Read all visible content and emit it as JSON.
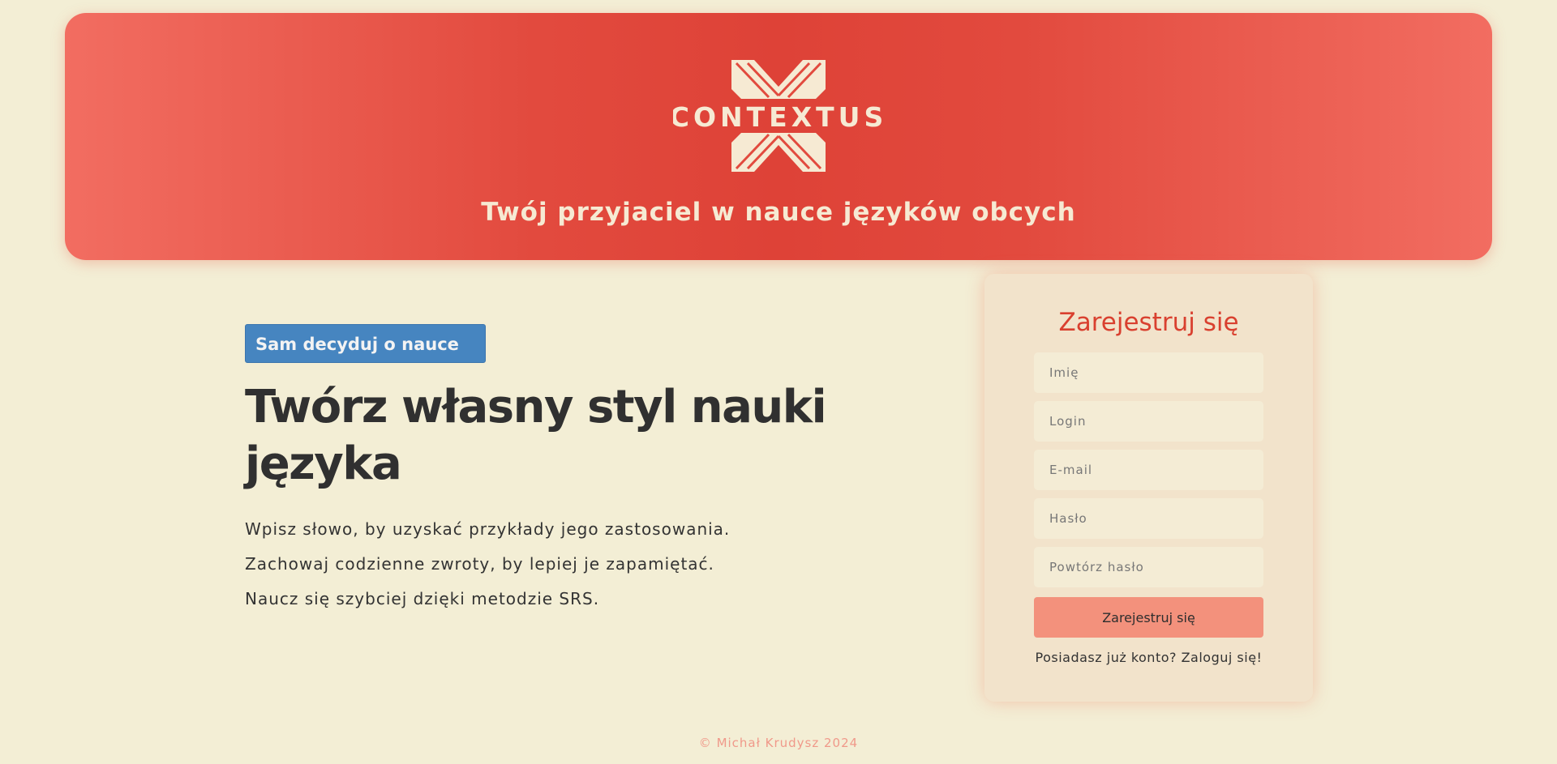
{
  "header": {
    "logo_text": "CONTEXTUS",
    "tagline": "Twój przyjaciel w nauce języków obcych"
  },
  "intro": {
    "badge": "Sam decyduj o nauce",
    "headline": "Twórz własny styl nauki języka",
    "features": [
      "Wpisz słowo, by uzyskać przykłady jego zastosowania.",
      "Zachowaj codzienne zwroty, by lepiej je zapamiętać.",
      "Naucz się szybciej dzięki metodzie SRS."
    ]
  },
  "register": {
    "title": "Zarejestruj się",
    "fields": {
      "name_placeholder": "Imię",
      "login_placeholder": "Login",
      "email_placeholder": "E-mail",
      "password_placeholder": "Hasło",
      "repeat_password_placeholder": "Powtórz hasło"
    },
    "submit_label": "Zarejestruj się",
    "login_prompt": "Posiadasz już konto?",
    "login_link": "Zaloguj się!"
  },
  "footer": {
    "copyright": "© Michał Krudysz 2024"
  },
  "colors": {
    "hero_red": "#de4237",
    "hero_light": "#f26d61",
    "cream": "#f3eed5",
    "logo_cream": "#f6ead3",
    "badge_blue": "#4685c0",
    "title_red": "#d9402f",
    "button_salmon": "#f3917c",
    "footer_pink": "#f0998a"
  }
}
